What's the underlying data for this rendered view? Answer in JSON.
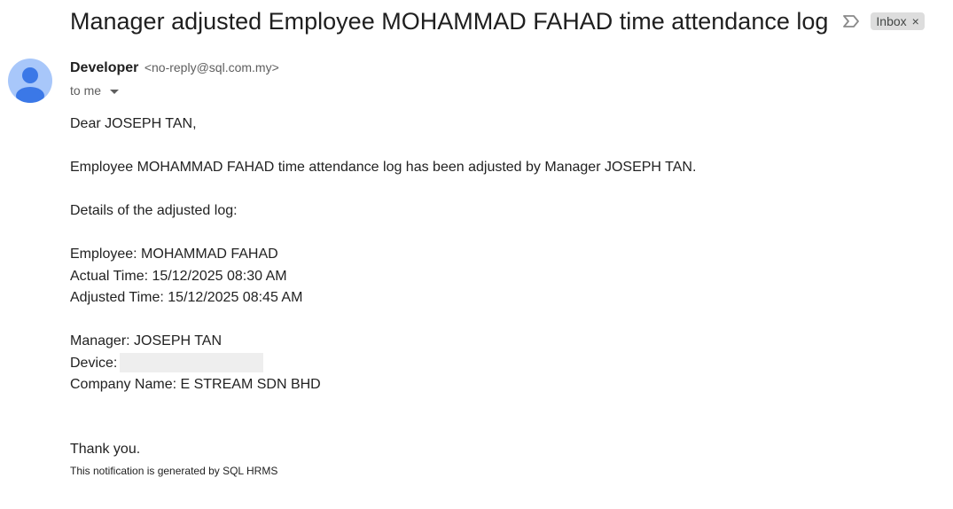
{
  "subject": "Manager adjusted Employee MOHAMMAD FAHAD time attendance log",
  "label_chip": {
    "label": "Inbox",
    "close": "×"
  },
  "sender": {
    "name": "Developer",
    "email": "<no-reply@sql.com.my>"
  },
  "recipient_line": "to me",
  "message": {
    "greeting": "Dear JOSEPH TAN,",
    "intro": "Employee MOHAMMAD FAHAD time attendance log has been adjusted by Manager JOSEPH TAN.",
    "details_heading": "Details of the adjusted log:",
    "employee": "Employee: MOHAMMAD FAHAD",
    "actual_time": "Actual Time: 15/12/2025 08:30 AM",
    "adjusted_time": "Adjusted Time: 15/12/2025 08:45 AM",
    "manager": "Manager: JOSEPH TAN",
    "device_label": "Device:",
    "company": "Company Name: E STREAM SDN BHD",
    "closing": "Thank you.",
    "footer": "This notification is generated by SQL HRMS"
  },
  "icons": {
    "important": "important-marker-icon",
    "avatar": "default-avatar-icon",
    "expand": "chevron-down-icon"
  },
  "colors": {
    "avatar_bg": "#a8c7fa",
    "avatar_fg": "#3b78e7",
    "chip_bg": "#dddddd"
  }
}
